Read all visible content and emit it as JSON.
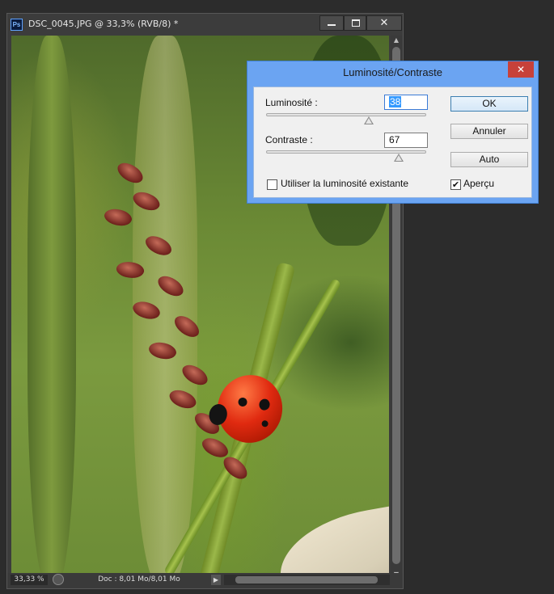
{
  "document": {
    "app_icon": "Ps",
    "title": "DSC_0045.JPG @ 33,3% (RVB/8) *",
    "window_controls": {
      "minimize": "minimize-icon",
      "maximize": "maximize-icon",
      "close": "✕"
    }
  },
  "status_bar": {
    "zoom": "33,33 %",
    "doc_info": "Doc : 8,01 Mo/8,01 Mo",
    "menu_arrow": "▶"
  },
  "dialog": {
    "title": "Luminosité/Contraste",
    "close": "✕",
    "brightness": {
      "label": "Luminosité :",
      "value": "38",
      "level_pct": 64
    },
    "contrast": {
      "label": "Contraste :",
      "value": "67",
      "level_pct": 83
    },
    "legacy": {
      "label": "Utiliser la luminosité existante",
      "checked": false
    },
    "buttons": {
      "ok": "OK",
      "cancel": "Annuler",
      "auto": "Auto"
    },
    "preview": {
      "label": "Aperçu",
      "checked": true,
      "mark": "✔"
    }
  },
  "colors": {
    "dialog_frame": "#6ba4f2",
    "close_button": "#c7413a",
    "selection": "#3399ff"
  }
}
